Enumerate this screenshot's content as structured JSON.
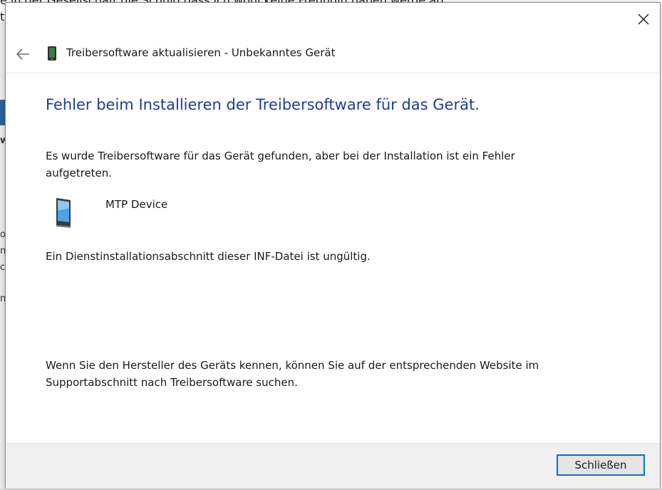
{
  "background": {
    "text_line_1": "e in der Gesellschaft die Schuld dass ich wohl keine Freundin haben werde ab",
    "text_line_2": "t",
    "frag_1": "w",
    "frag_2": "o",
    "frag_3": "n",
    "frag_4": "c",
    "frag_5": "n"
  },
  "dialog": {
    "header_title": "Treibersoftware aktualisieren - Unbekanntes Gerät",
    "heading": "Fehler beim Installieren der Treibersoftware für das Gerät.",
    "description": "Es wurde Treibersoftware für das Gerät gefunden, aber bei der Installation ist ein Fehler aufgetreten.",
    "device_name": "MTP Device",
    "error_message": "Ein Dienstinstallationsabschnitt dieser INF-Datei ist ungültig.",
    "hint": "Wenn Sie den Hersteller des Geräts kennen, können Sie auf der entsprechenden Website im Supportabschnitt nach Treibersoftware suchen.",
    "close_button_label": "Schließen"
  },
  "icons": {
    "close": "close-icon",
    "back": "back-arrow-icon",
    "device_small": "device-icon",
    "device_large": "mobile-device-icon"
  },
  "colors": {
    "heading": "#1e3d9a",
    "button_focus_border": "#0b6fcf",
    "footer_bg": "#f0f0f0"
  }
}
